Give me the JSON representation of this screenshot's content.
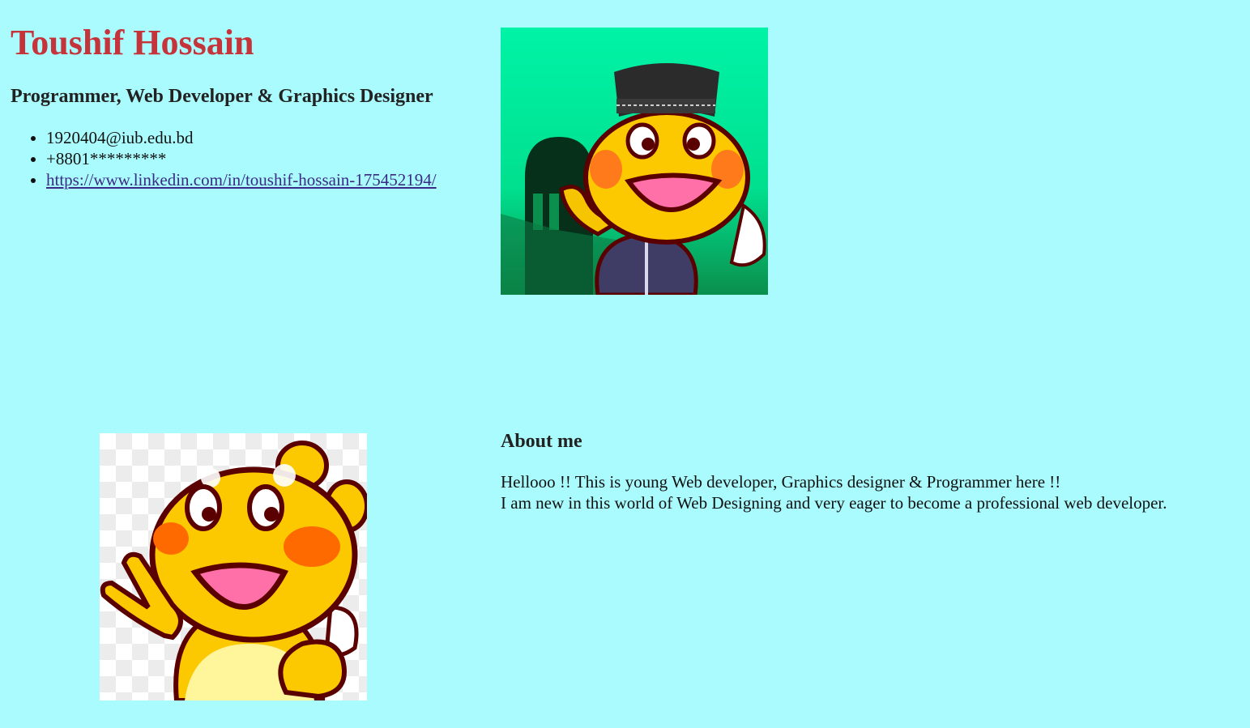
{
  "profile": {
    "name": "Toushif Hossain",
    "tagline": "Programmer, Web Developer & Graphics Designer",
    "contacts": [
      "1920404@iub.edu.bd",
      "+8801*********",
      "https://www.linkedin.com/in/toushif-hossain-175452194/"
    ]
  },
  "about": {
    "title": "About me",
    "line1": "Hellooo !! This is young Web developer, Graphics designer & Programmer here !!",
    "line2": "I am new in this world of Web Designing and very eager to become a professional web developer."
  },
  "images": {
    "top": "cartoon-mascot-with-cap-and-mosque-image",
    "bottom": "cartoon-mascot-peace-sign-image"
  },
  "colors": {
    "background": "#aafbfd",
    "name": "#c4343a",
    "link": "#3a2a86"
  }
}
